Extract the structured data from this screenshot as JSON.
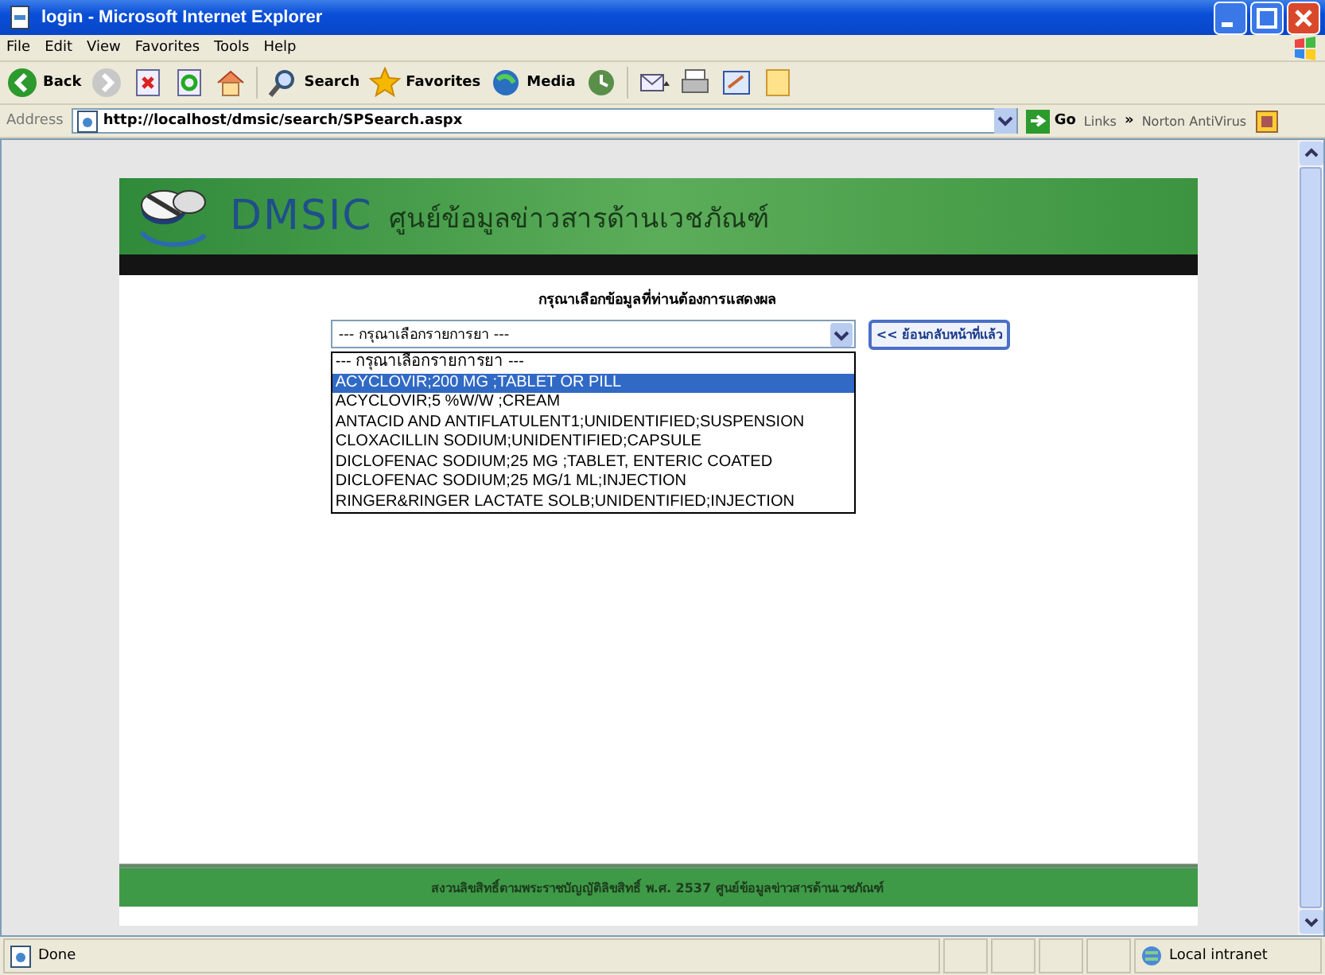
{
  "window": {
    "title": "login - Microsoft Internet Explorer"
  },
  "menu": [
    "File",
    "Edit",
    "View",
    "Favorites",
    "Tools",
    "Help"
  ],
  "toolbar": [
    {
      "kind": "back",
      "label": "Back"
    },
    {
      "kind": "forward"
    },
    {
      "kind": "stop"
    },
    {
      "kind": "refresh"
    },
    {
      "kind": "home"
    },
    {
      "kind": "search",
      "label": "Search"
    },
    {
      "kind": "favorites",
      "label": "Favorites"
    },
    {
      "kind": "media",
      "label": "Media"
    },
    {
      "kind": "history"
    },
    {
      "kind": "mail"
    },
    {
      "kind": "print"
    },
    {
      "kind": "edit"
    },
    {
      "kind": "note"
    }
  ],
  "address": {
    "label": "Address",
    "value": "http://localhost/dmsic/search/SPSearch.aspx",
    "go": "Go",
    "links": "Links",
    "chevron": "»",
    "norton": "Norton AntiVirus"
  },
  "site": {
    "logo": "DMSIC",
    "subtitle": "ศูนย์ข้อมูลข่าวสารด้านเวชภัณฑ์"
  },
  "form": {
    "heading": "กรุณาเลือกข้อมูลที่ท่านต้องการแสดงผล",
    "select_value": "--- กรุณาเลือกรายการยา ---",
    "back_button": "<< ย้อนกลับหน้าที่แล้ว",
    "options": [
      {
        "label": "--- กรุณาเลือกรายการยา ---",
        "selected": false
      },
      {
        "label": "ACYCLOVIR;200 MG ;TABLET OR PILL",
        "selected": true
      },
      {
        "label": "ACYCLOVIR;5 %W/W ;CREAM",
        "selected": false
      },
      {
        "label": "ANTACID AND ANTIFLATULENT1;UNIDENTIFIED;SUSPENSION",
        "selected": false
      },
      {
        "label": "CLOXACILLIN SODIUM;UNIDENTIFIED;CAPSULE",
        "selected": false
      },
      {
        "label": "DICLOFENAC SODIUM;25 MG ;TABLET, ENTERIC COATED",
        "selected": false
      },
      {
        "label": "DICLOFENAC SODIUM;25 MG/1 ML;INJECTION",
        "selected": false
      },
      {
        "label": "RINGER&RINGER LACTATE SOLB;UNIDENTIFIED;INJECTION",
        "selected": false
      }
    ]
  },
  "footer": "สงวนลิขสิทธิ์ตามพระราชบัญญัติลิขสิทธิ์ พ.ศ. 2537 ศูนย์ข้อมูลข่าวสารด้านเวชภัณฑ์",
  "status_bar": {
    "text": "Done",
    "zone": "Local intranet"
  }
}
